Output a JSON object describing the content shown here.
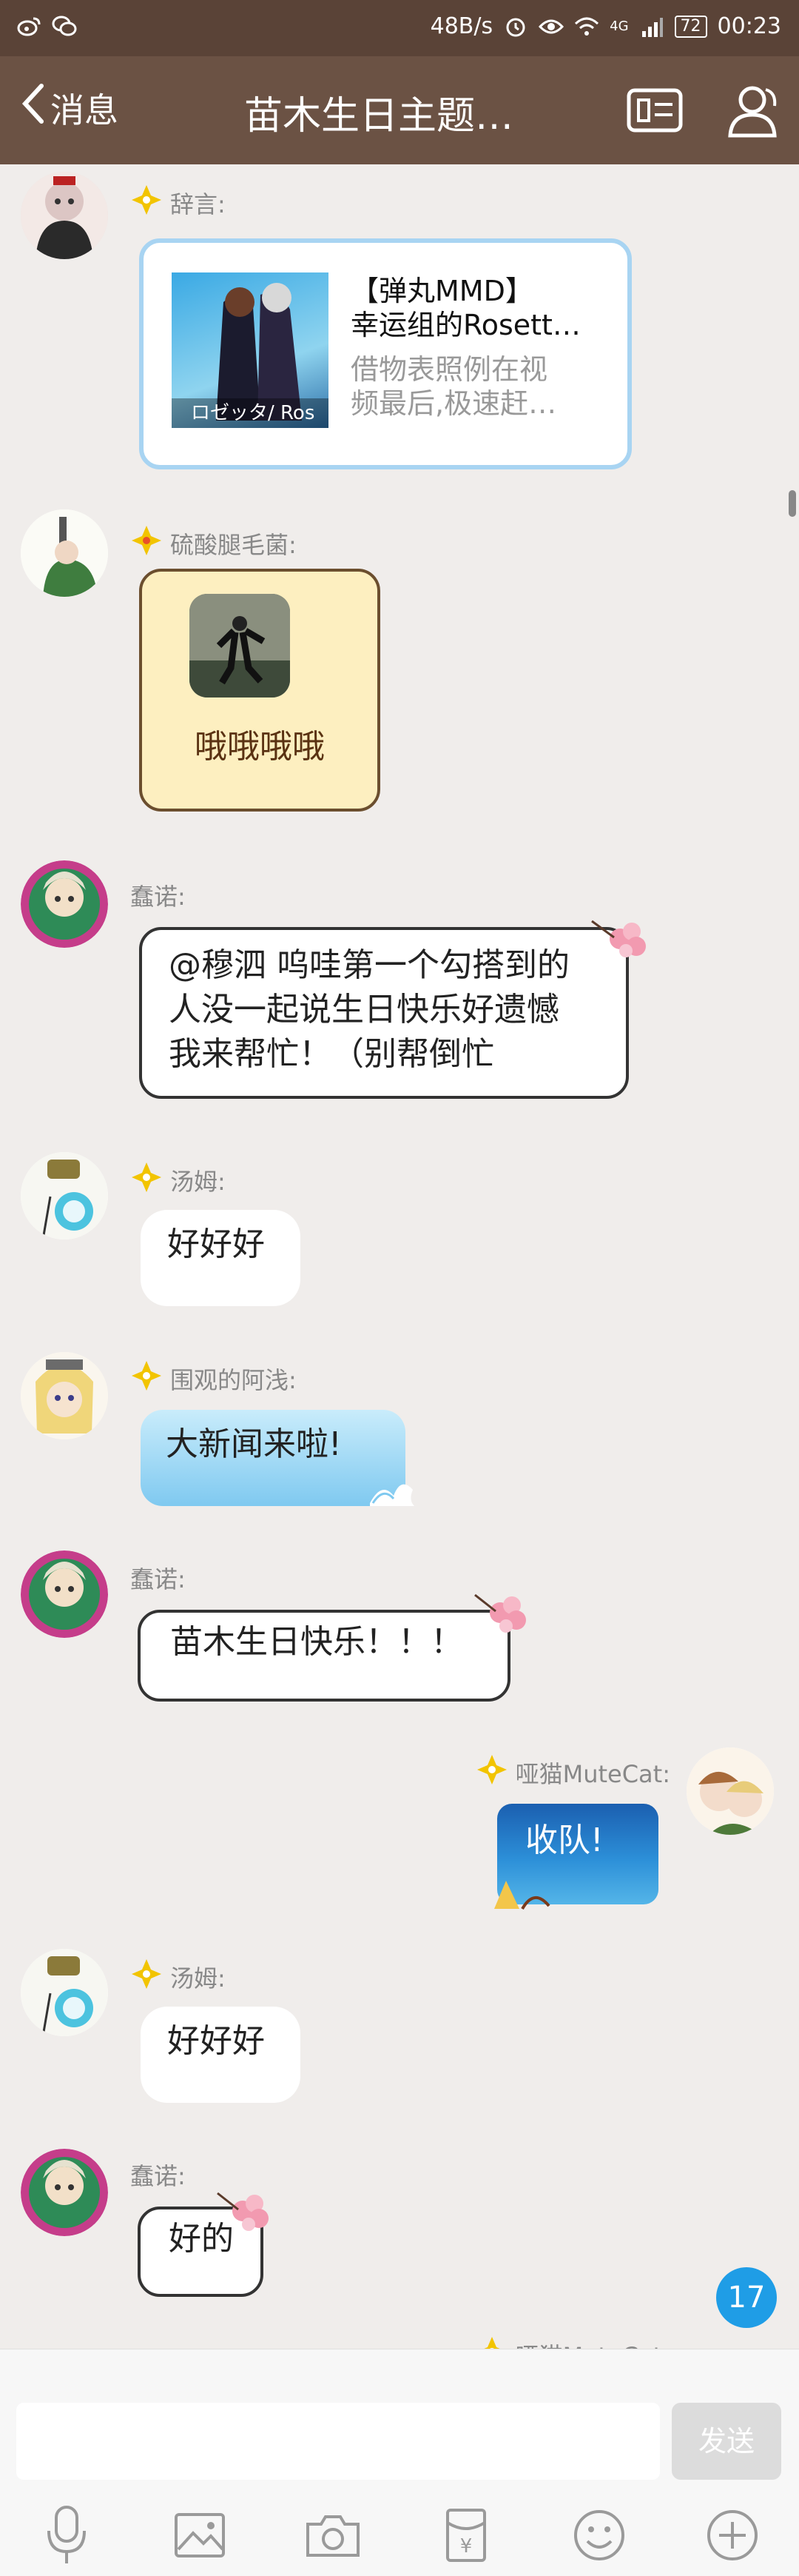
{
  "statusbar": {
    "speed": "48B/s",
    "network": "4G",
    "battery": "72",
    "time": "00:23"
  },
  "header": {
    "back_label": "消息",
    "title": "苗木生日主题…"
  },
  "messages": [
    {
      "name": "辞言:",
      "share": {
        "title_line1": "【弹丸MMD】",
        "title_line2": "幸运组的Rosett…",
        "desc_line1": "借物表照例在视",
        "desc_line2": "频最后,极速赶…",
        "thumb_caption": "ロゼッタ/ Ros"
      }
    },
    {
      "name": "硫酸腿毛菌:",
      "text": "哦哦哦哦"
    },
    {
      "name": "蠢诺:",
      "lines": [
        "@穆泗 呜哇第一个勾搭到的",
        "人没一起说生日快乐好遗憾",
        "我来帮忙！（别帮倒忙"
      ]
    },
    {
      "name": "汤姆:",
      "text": "好好好"
    },
    {
      "name": "围观的阿浅:",
      "text": "大新闻来啦!"
    },
    {
      "name": "蠢诺:",
      "text": "苗木生日快乐！！！"
    },
    {
      "name": "哑猫MuteCat:",
      "text": "收队!"
    },
    {
      "name": "汤姆:",
      "text": "好好好"
    },
    {
      "name": "蠢诺:",
      "text": "好的"
    },
    {
      "name": "哑猫MuteCat:"
    }
  ],
  "unread_count": "17",
  "input": {
    "send_label": "发送"
  },
  "toolbar": {
    "icons": [
      "microphone-icon",
      "image-icon",
      "camera-icon",
      "red-packet-icon",
      "emoji-icon",
      "plus-icon"
    ],
    "red_packet_symbol": "¥"
  }
}
